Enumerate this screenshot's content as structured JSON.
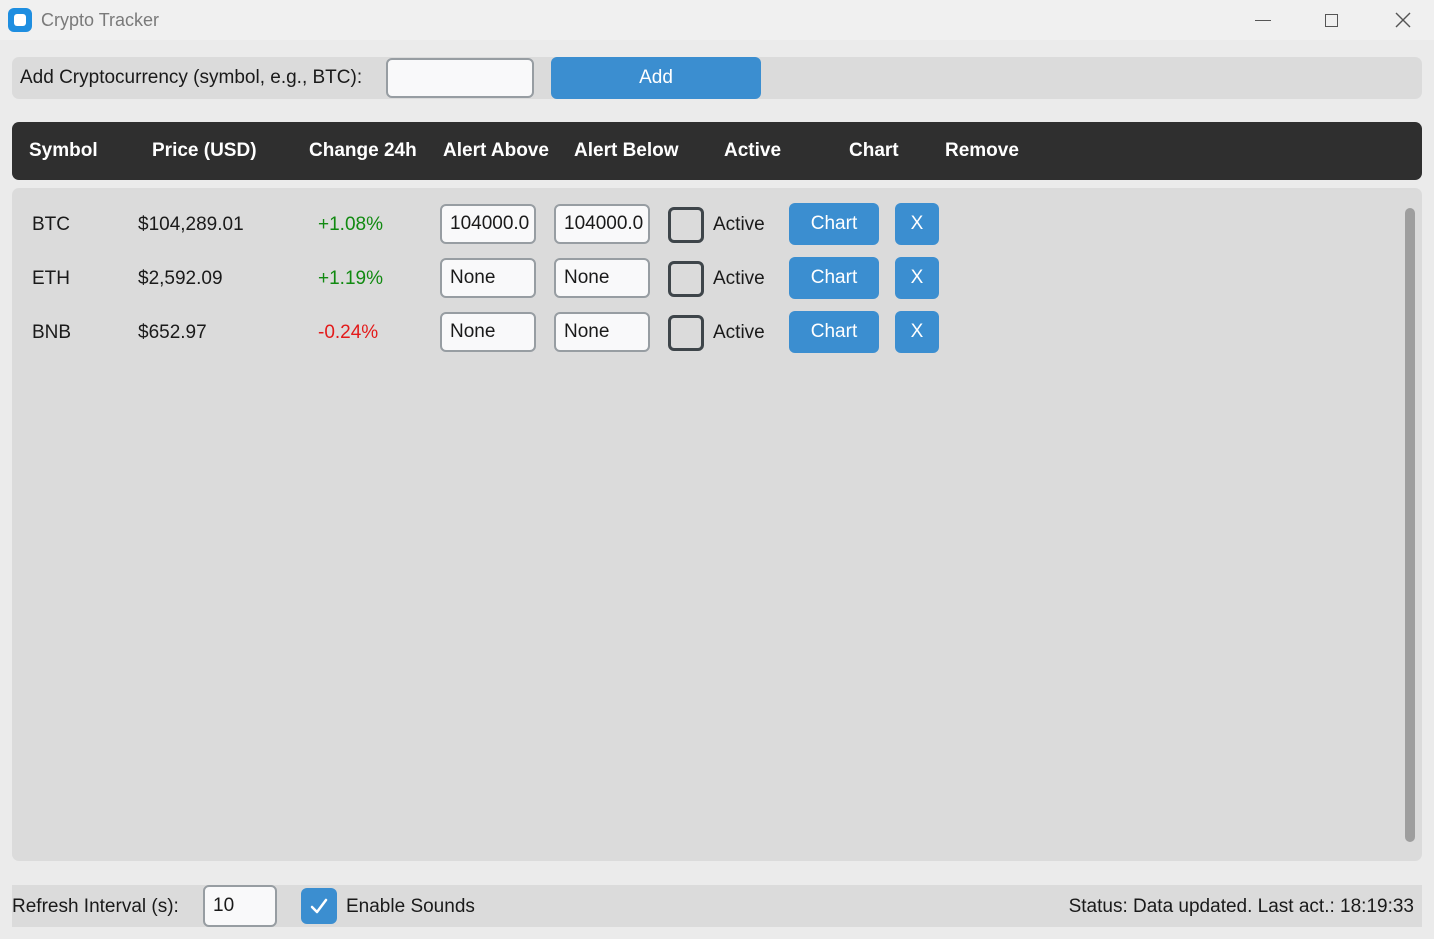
{
  "window": {
    "title": "Crypto Tracker"
  },
  "add_bar": {
    "label": "Add Cryptocurrency (symbol, e.g., BTC):",
    "input_value": "",
    "input_placeholder": "",
    "button_label": "Add"
  },
  "header": {
    "columns": [
      "Symbol",
      "Price (USD)",
      "Change 24h",
      "Alert Above",
      "Alert Below",
      "Active",
      "Chart",
      "Remove"
    ]
  },
  "rows": [
    {
      "symbol": "BTC",
      "price": "$104,289.01",
      "change": "+1.08%",
      "change_direction": "up",
      "alert_above": "104000.0",
      "alert_below": "104000.0",
      "active_checked": false,
      "active_label": "Active",
      "chart_label": "Chart",
      "remove_label": "X"
    },
    {
      "symbol": "ETH",
      "price": "$2,592.09",
      "change": "+1.19%",
      "change_direction": "up",
      "alert_above": "None",
      "alert_below": "None",
      "active_checked": false,
      "active_label": "Active",
      "chart_label": "Chart",
      "remove_label": "X"
    },
    {
      "symbol": "BNB",
      "price": "$652.97",
      "change": "-0.24%",
      "change_direction": "down",
      "alert_above": "None",
      "alert_below": "None",
      "active_checked": false,
      "active_label": "Active",
      "chart_label": "Chart",
      "remove_label": "X"
    }
  ],
  "bottom_bar": {
    "refresh_label": "Refresh Interval (s):",
    "refresh_value": "10",
    "sounds_label": "Enable Sounds",
    "sounds_checked": true,
    "status": "Status: Data updated. Last act.: 18:19:33"
  },
  "colors": {
    "accent": "#3b8ed0",
    "header_bg": "#2f2f2f",
    "positive": "#118a11",
    "negative": "#e31b1b",
    "panel_bg": "#dbdbdb",
    "window_bg": "#ebebeb"
  },
  "icons": {
    "app": "app-icon",
    "minimize": "minimize-icon",
    "maximize": "maximize-icon",
    "close": "close-icon",
    "check": "checkmark-icon"
  }
}
